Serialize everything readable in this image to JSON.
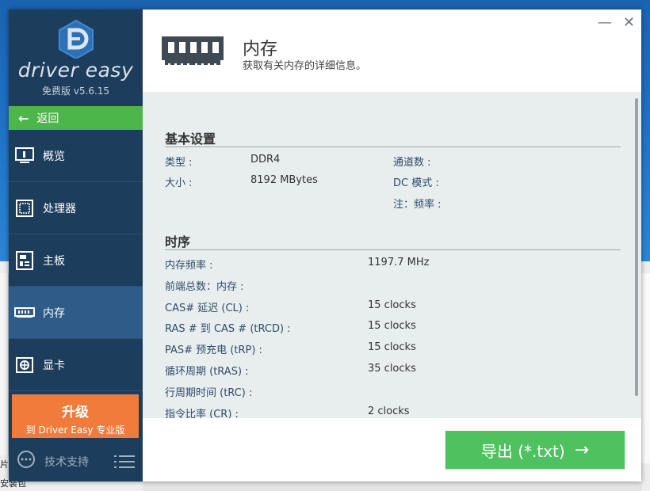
{
  "app": {
    "logo_text": "driver easy",
    "version": "免费版 v5.6.15"
  },
  "sidebar": {
    "back_label": "返回",
    "items": [
      {
        "label": "概览",
        "icon": "monitor-icon"
      },
      {
        "label": "处理器",
        "icon": "cpu-icon"
      },
      {
        "label": "主板",
        "icon": "motherboard-icon"
      },
      {
        "label": "内存",
        "icon": "memory-icon",
        "active": true
      },
      {
        "label": "显卡",
        "icon": "graphics-card-icon"
      }
    ],
    "upgrade_title": "升级",
    "upgrade_sub": "到 Driver Easy 专业版",
    "support_label": "技术支持"
  },
  "header": {
    "title": "内存",
    "subtitle": "获取有关内存的详细信息。"
  },
  "basic": {
    "title": "基本设置",
    "rows": [
      {
        "label": "类型 :",
        "value": "DDR4"
      },
      {
        "label": "大小 :",
        "value": "8192 MBytes"
      }
    ],
    "right_rows": [
      {
        "label": "通道数 :"
      },
      {
        "label": "DC 模式 :"
      },
      {
        "label": "注：频率 :"
      }
    ]
  },
  "timing": {
    "title": "时序",
    "rows": [
      {
        "label": "内存频率 :",
        "value": "1197.7 MHz"
      },
      {
        "label": "前端总数：内存 :",
        "value": ""
      },
      {
        "label": "CAS# 延迟 (CL) :",
        "value": "15 clocks"
      },
      {
        "label": "RAS # 到 CAS # (tRCD) :",
        "value": "15 clocks"
      },
      {
        "label": "PAS# 预充电 (tRP) :",
        "value": "15 clocks"
      },
      {
        "label": "循环周期 (tRAS) :",
        "value": "35 clocks"
      },
      {
        "label": "行周期时间 (tRC) :",
        "value": ""
      },
      {
        "label": "指令比率 (CR) :",
        "value": "2 clocks"
      }
    ]
  },
  "footer": {
    "export_label": "导出 (*.txt)"
  },
  "desktop": {
    "left_text_1": "片",
    "left_text_2": "安装包"
  },
  "colors": {
    "sidebar_bg": "#1d3d5c",
    "back_green": "#4db64a",
    "upgrade_orange": "#f07b3b",
    "export_green": "#4ec25e",
    "content_bg": "#e8eeee"
  }
}
